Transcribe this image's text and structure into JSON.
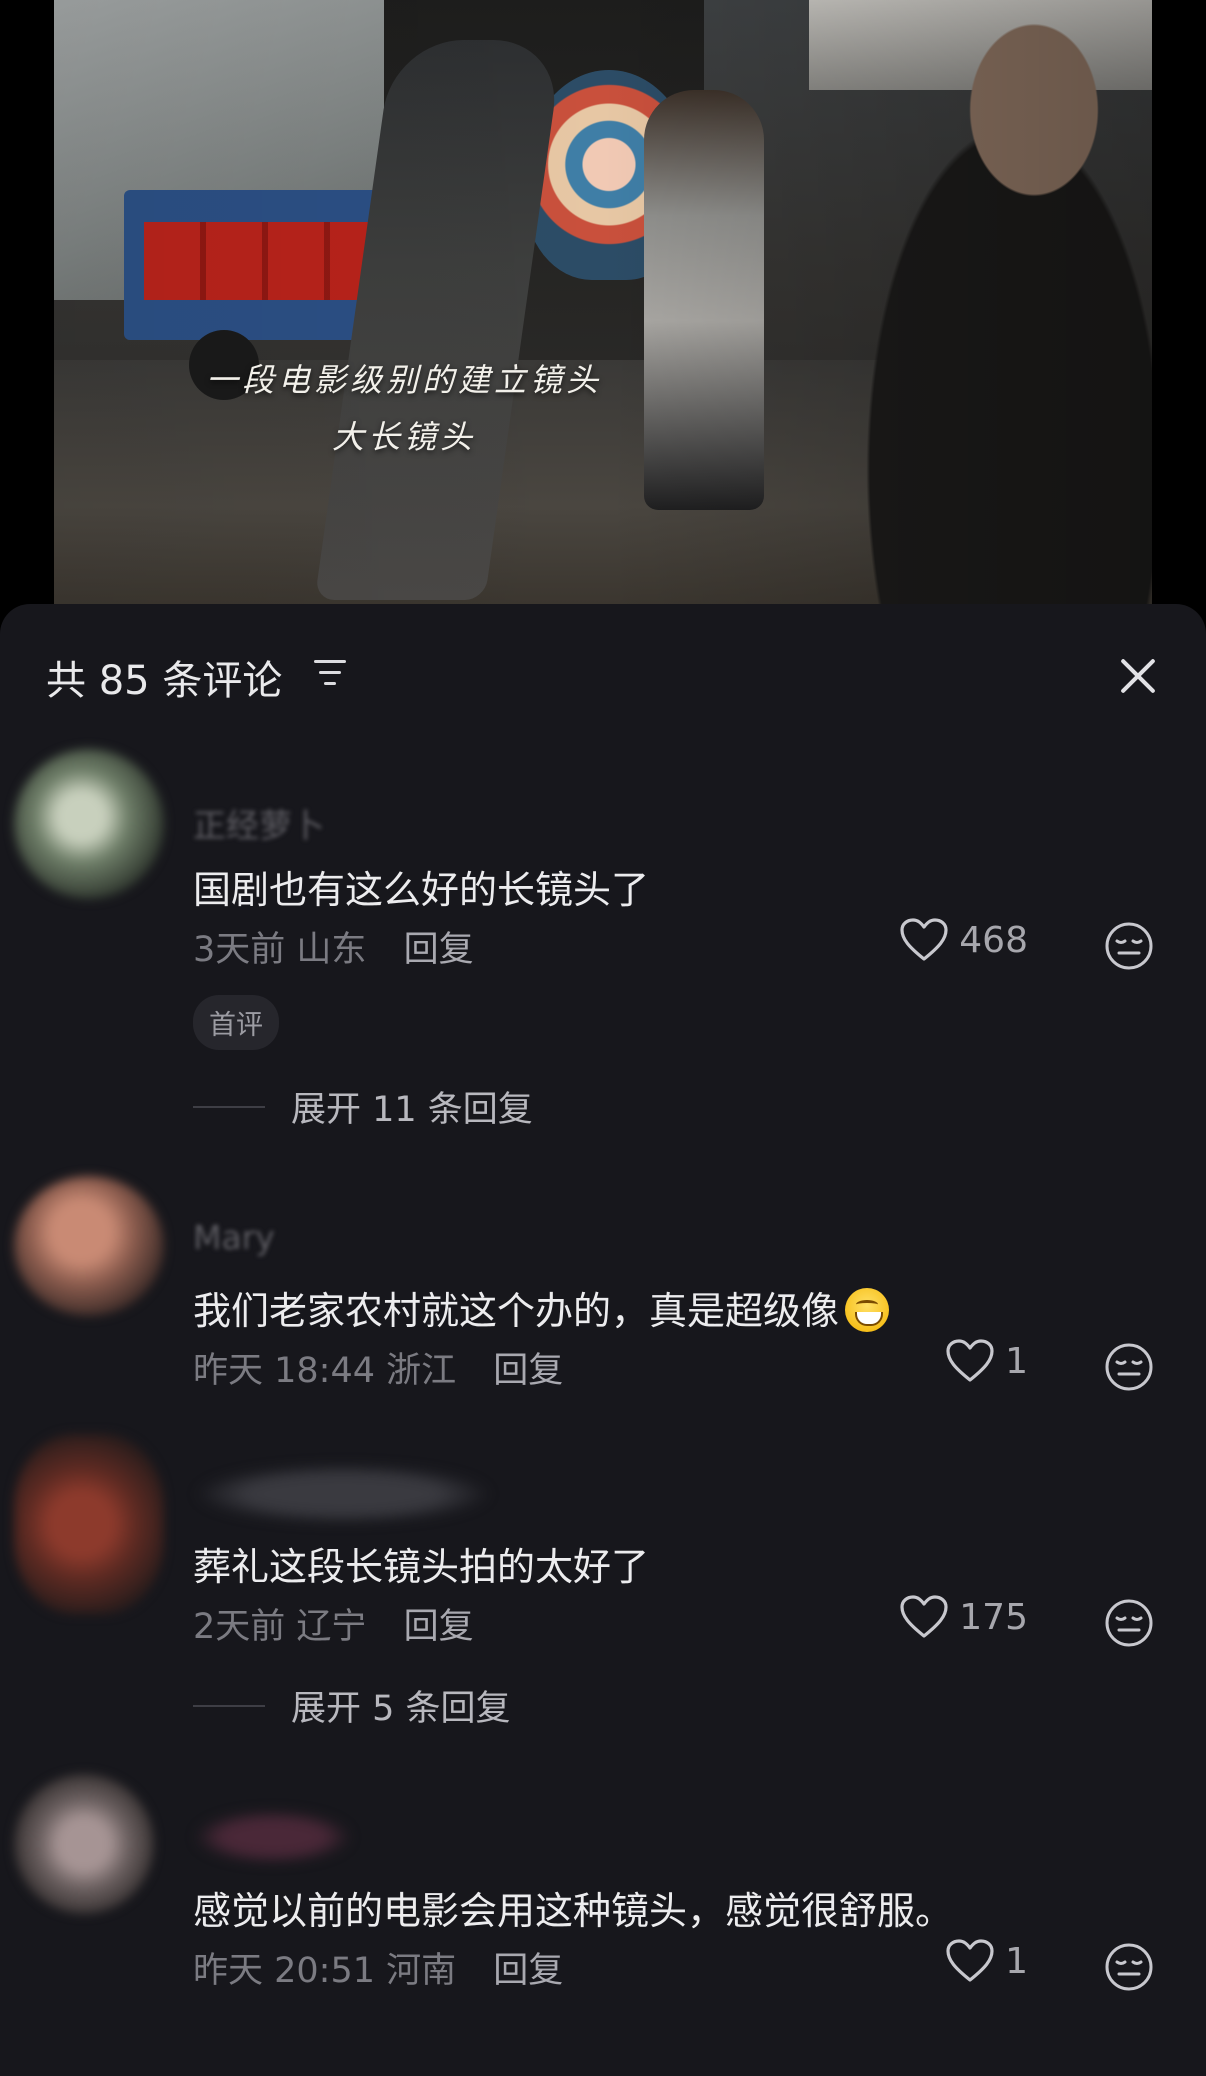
{
  "video": {
    "subtitle_line1": "一段电影级别的建立镜头",
    "subtitle_line2": "大长镜头"
  },
  "panel": {
    "title": "共 85 条评论",
    "sort_icon": "sort-filter-icon",
    "close_icon": "close-icon"
  },
  "comments": [
    {
      "username": "正经萝卜",
      "text": "国剧也有这么好的长镜头了",
      "time": "3天前",
      "location": "山东",
      "reply_label": "回复",
      "likes": "468",
      "badge": "首评",
      "expand": "展开 11 条回复",
      "avatar_color": "#6e7e68"
    },
    {
      "username": "Mary",
      "text": "我们老家农村就这个办的，真是超级像",
      "time": "昨天 18:44",
      "location": "浙江",
      "reply_label": "回复",
      "likes": "1",
      "avatar_color": "#8a5b4d"
    },
    {
      "username": "",
      "text": "葬礼这段长镜头拍的太好了",
      "time": "2天前",
      "location": "辽宁",
      "reply_label": "回复",
      "likes": "175",
      "expand": "展开 5 条回复",
      "avatar_color": "#5e2a22"
    },
    {
      "username": "",
      "text": "感觉以前的电影会用这种镜头，感觉很舒服。",
      "time": "昨天 20:51",
      "location": "河南",
      "reply_label": "回复",
      "likes": "1",
      "avatar_color": "#6b6060"
    }
  ],
  "icons": {
    "like": "heart-outline-icon",
    "dislike": "neutral-face-icon",
    "emoji": "grinning-face-emoji"
  },
  "colors": {
    "sheet_background": "#17171c",
    "text_primary": "#ececee",
    "text_secondary": "#7b7b82"
  }
}
